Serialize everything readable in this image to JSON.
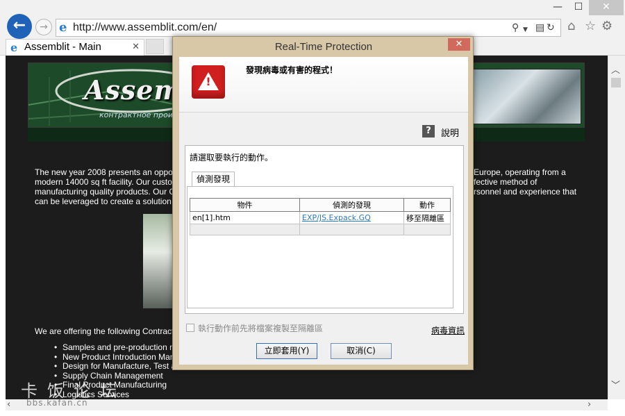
{
  "browser": {
    "window_buttons": {
      "minimize": "—",
      "maximize": "☐",
      "close": "✕"
    },
    "address_url": "http://www.assemblit.com/en/",
    "tab_title": "Assemblit - Main",
    "icons": {
      "back": "back-arrow-icon",
      "forward": "forward-arrow-icon",
      "search": "search-icon",
      "compat": "compatibility-view-icon",
      "refresh": "refresh-icon",
      "home": "home-icon",
      "favorites": "star-icon",
      "settings": "gear-icon"
    }
  },
  "page": {
    "logo": "Assemblit",
    "logo_tagline": "контрактное прои",
    "intro_lines": [
      "The new year 2008 presents an oppo",
      "modern 14000 sq ft facility. Our custo",
      "manufacturing quality products. Our C",
      "can be leveraged to create a solution"
    ],
    "intro_right_lines": [
      "Europe, operating from a",
      "fective method of",
      "rsonnel and experience that"
    ],
    "offer_text": "We are offering the following Contract",
    "services": [
      "Samples and pre-production n",
      "New Product Introduction Man",
      "Design for Manufacture, Test a",
      "Supply Chain Management",
      "Final Product Manufacturing",
      "Logistics Services"
    ]
  },
  "dialog": {
    "title": "Real-Time Protection",
    "close_label": "✕",
    "alert_title": "發現病毒或有害的程式！",
    "help_label": "說明",
    "instruction": "請選取要執行的動作。",
    "tab_label": "偵測發現",
    "table": {
      "headers": [
        "物件",
        "偵測的發現",
        "動作"
      ],
      "rows": [
        {
          "object": "en[1].htm",
          "finding": "EXP/JS.Expack.GQ",
          "action": "移至隔離區"
        }
      ]
    },
    "copy_checkbox_label": "執行動作前先將檔案複製至隔離區",
    "copy_checked": false,
    "virus_info_link": "病毒資訊",
    "apply_button": "立即套用(Y)",
    "cancel_button": "取消(C)"
  },
  "watermark": {
    "text": "卡饭论坛",
    "url": "bbs.kafan.cn"
  }
}
